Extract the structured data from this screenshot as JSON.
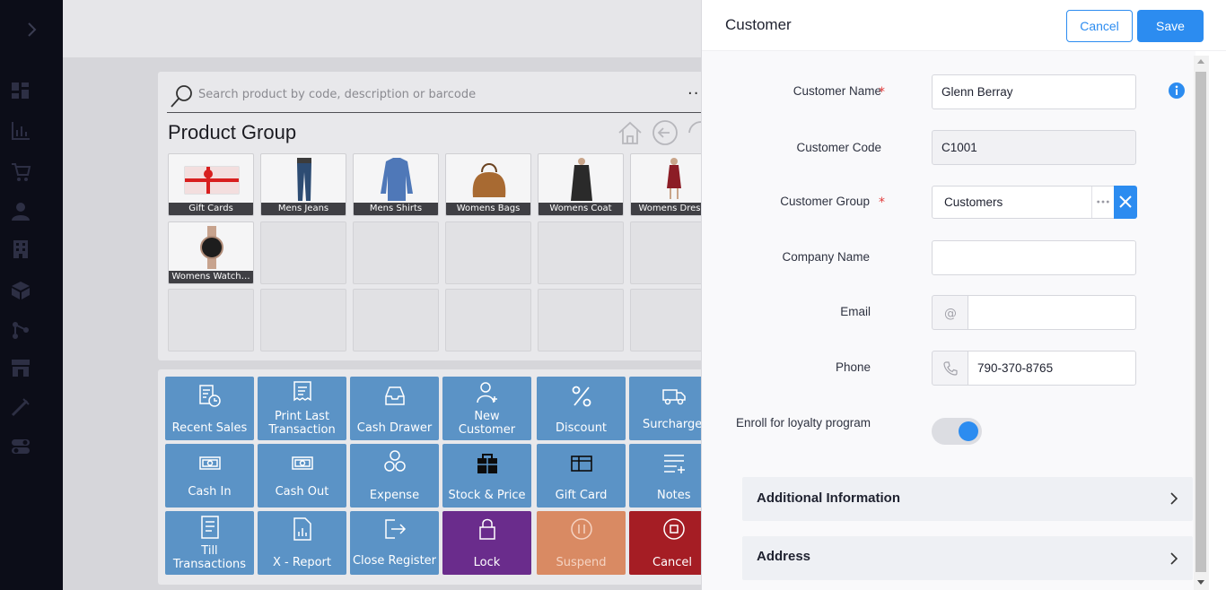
{
  "search": {
    "placeholder": "Search product by code, description or barcode"
  },
  "product_group": {
    "title": "Product Group",
    "tiles": [
      {
        "label": "Gift Cards",
        "icon": "gift-card-image"
      },
      {
        "label": "Mens Jeans",
        "icon": "jeans-image"
      },
      {
        "label": "Mens Shirts",
        "icon": "shirt-image"
      },
      {
        "label": "Womens Bags",
        "icon": "bag-image"
      },
      {
        "label": "Womens Coat",
        "icon": "coat-image"
      },
      {
        "label": "Womens Dres",
        "icon": "dress-image"
      },
      {
        "label": "Womens Watch…",
        "icon": "watch-image"
      }
    ]
  },
  "functions": [
    {
      "label": "Recent Sales",
      "icon": "recent-sales-icon"
    },
    {
      "label": "Print Last Transaction",
      "icon": "receipt-icon"
    },
    {
      "label": "Cash Drawer",
      "icon": "drawer-icon"
    },
    {
      "label": "New Customer",
      "icon": "add-user-icon"
    },
    {
      "label": "Discount",
      "icon": "percent-icon"
    },
    {
      "label": "Surcharge",
      "icon": "truck-icon"
    },
    {
      "label": "Cash In",
      "icon": "cash-icon"
    },
    {
      "label": "Cash Out",
      "icon": "cash-icon"
    },
    {
      "label": "Expense",
      "icon": "coins-icon"
    },
    {
      "label": "Stock & Price",
      "icon": "stock-icon"
    },
    {
      "label": "Gift Card",
      "icon": "gift-card-icon"
    },
    {
      "label": "Notes",
      "icon": "notes-icon"
    },
    {
      "label": "Till Transactions",
      "icon": "list-icon"
    },
    {
      "label": "X - Report",
      "icon": "report-icon"
    },
    {
      "label": "Close Register",
      "icon": "exit-icon"
    },
    {
      "label": "Lock",
      "icon": "lock-icon"
    },
    {
      "label": "Suspend",
      "icon": "pause-icon"
    },
    {
      "label": "Cancel",
      "icon": "stop-icon"
    }
  ],
  "drawer": {
    "title": "Customer",
    "cancel_label": "Cancel",
    "save_label": "Save",
    "fields": {
      "customer_name": {
        "label": "Customer Name",
        "value": "Glenn Berray",
        "required": "*"
      },
      "customer_code": {
        "label": "Customer Code",
        "value": "C1001"
      },
      "customer_group": {
        "label": "Customer Group",
        "value": "Customers",
        "required": "*"
      },
      "company_name": {
        "label": "Company Name",
        "value": ""
      },
      "email": {
        "label": "Email",
        "value": ""
      },
      "phone": {
        "label": "Phone",
        "value": "790-370-8765"
      },
      "loyalty": {
        "label": "Enroll for loyalty program",
        "enabled": true
      }
    },
    "sections": {
      "additional": "Additional Information",
      "address": "Address"
    }
  },
  "colors": {
    "accent": "#2c8cf0",
    "required": "#e23b3b",
    "nav_bg": "#0c0d18"
  }
}
